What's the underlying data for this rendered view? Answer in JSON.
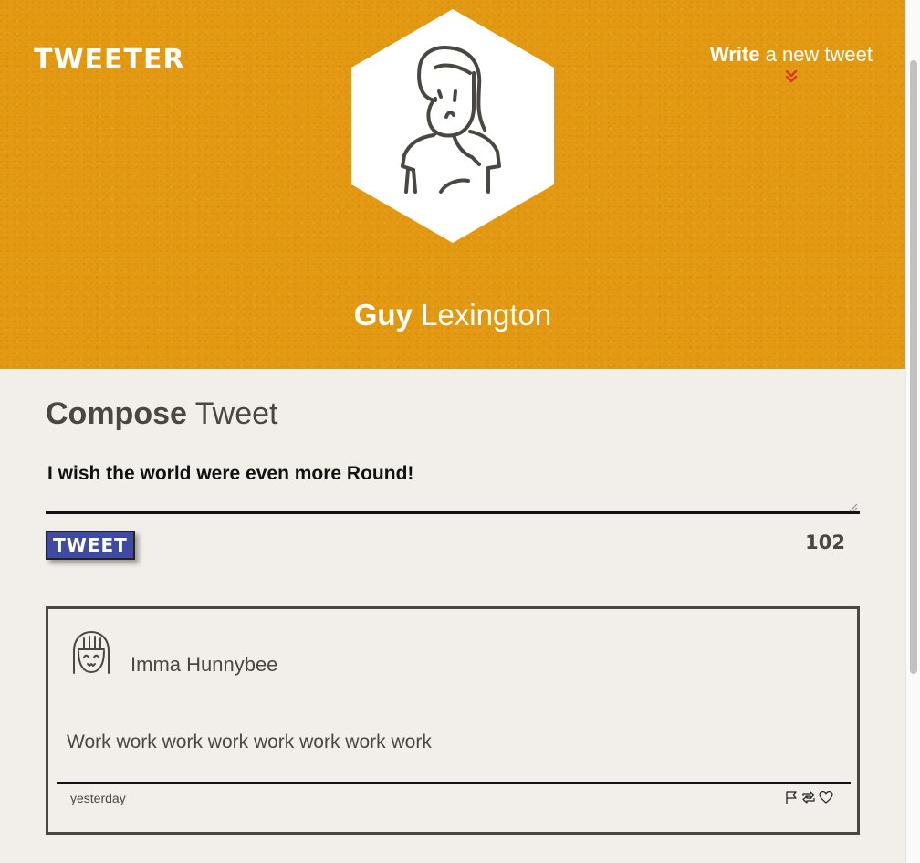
{
  "app": {
    "logo": "TWEETER"
  },
  "nav": {
    "write_bold": "Write",
    "write_rest": " a new tweet"
  },
  "profile": {
    "first_name": "Guy",
    "last_name": " Lexington"
  },
  "compose": {
    "title_bold": "Compose",
    "title_rest": " Tweet",
    "input_value": "I wish the world were even more Round!",
    "tweet_button": "TWEET",
    "char_count": "102"
  },
  "tweets": [
    {
      "author": "Imma Hunnybee",
      "text": "Work work work work work work work work",
      "timestamp": "yesterday",
      "actions": [
        "flag-icon",
        "retweet-icon",
        "heart-icon"
      ]
    }
  ],
  "colors": {
    "header_bg": "#e39a12",
    "page_bg": "#f2efea",
    "button_bg": "#3f4aa3",
    "text": "#4a4742",
    "chevron": "#d9381e"
  }
}
